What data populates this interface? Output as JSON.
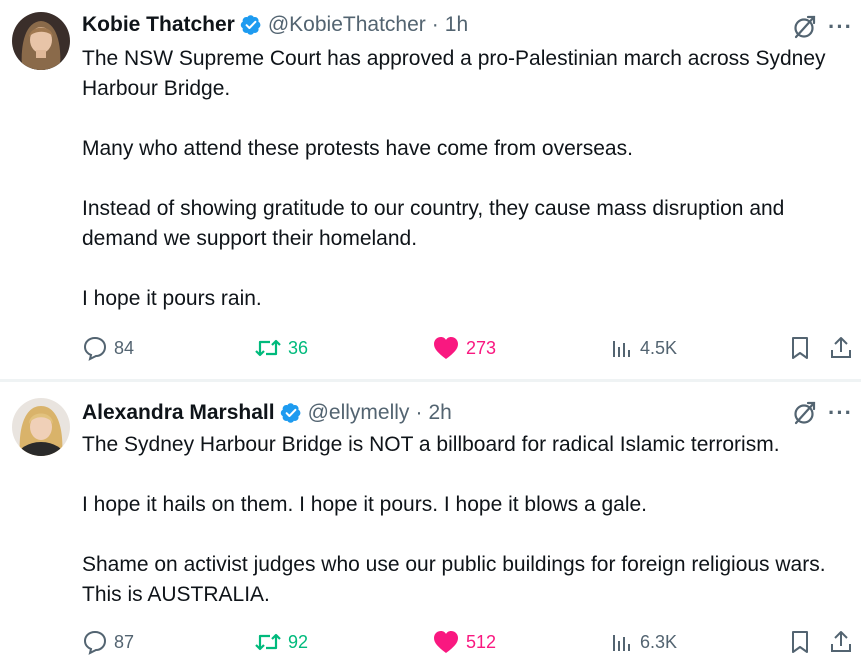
{
  "tweets": [
    {
      "author_name": "Kobie Thatcher",
      "handle": "@KobieThatcher",
      "separator": "·",
      "time": "1h",
      "paragraphs": [
        "The NSW Supreme Court has approved a pro-Palestinian march across Sydney Harbour Bridge.",
        "Many who attend these protests have come from overseas.",
        "Instead of showing gratitude to our country, they cause mass disruption and demand we support their homeland.",
        "I hope it pours rain."
      ],
      "replies": "84",
      "reposts": "36",
      "likes": "273",
      "views": "4.5K",
      "liked": true,
      "verified": true
    },
    {
      "author_name": "Alexandra Marshall",
      "handle": "@ellymelly",
      "separator": "·",
      "time": "2h",
      "paragraphs": [
        "The Sydney Harbour Bridge is NOT a billboard for radical Islamic terrorism.",
        "I hope it hails on them. I hope it pours. I hope it blows a gale.",
        "Shame on activist judges who use our public buildings for foreign religious wars. This is AUSTRALIA."
      ],
      "replies": "87",
      "reposts": "92",
      "likes": "512",
      "views": "6.3K",
      "liked": true,
      "verified": true
    }
  ],
  "icons": {
    "reply": "reply-icon",
    "repost": "repost-icon",
    "like": "heart-icon",
    "views": "views-icon",
    "bookmark": "bookmark-icon",
    "share": "share-icon",
    "grok": "grok-icon",
    "more": "more-icon",
    "verified": "verified-badge-icon"
  },
  "colors": {
    "text": "#0f1419",
    "muted": "#536471",
    "verified": "#1d9bf0",
    "repost": "#00ba7c",
    "like": "#f91880",
    "divider": "#eff3f4"
  }
}
